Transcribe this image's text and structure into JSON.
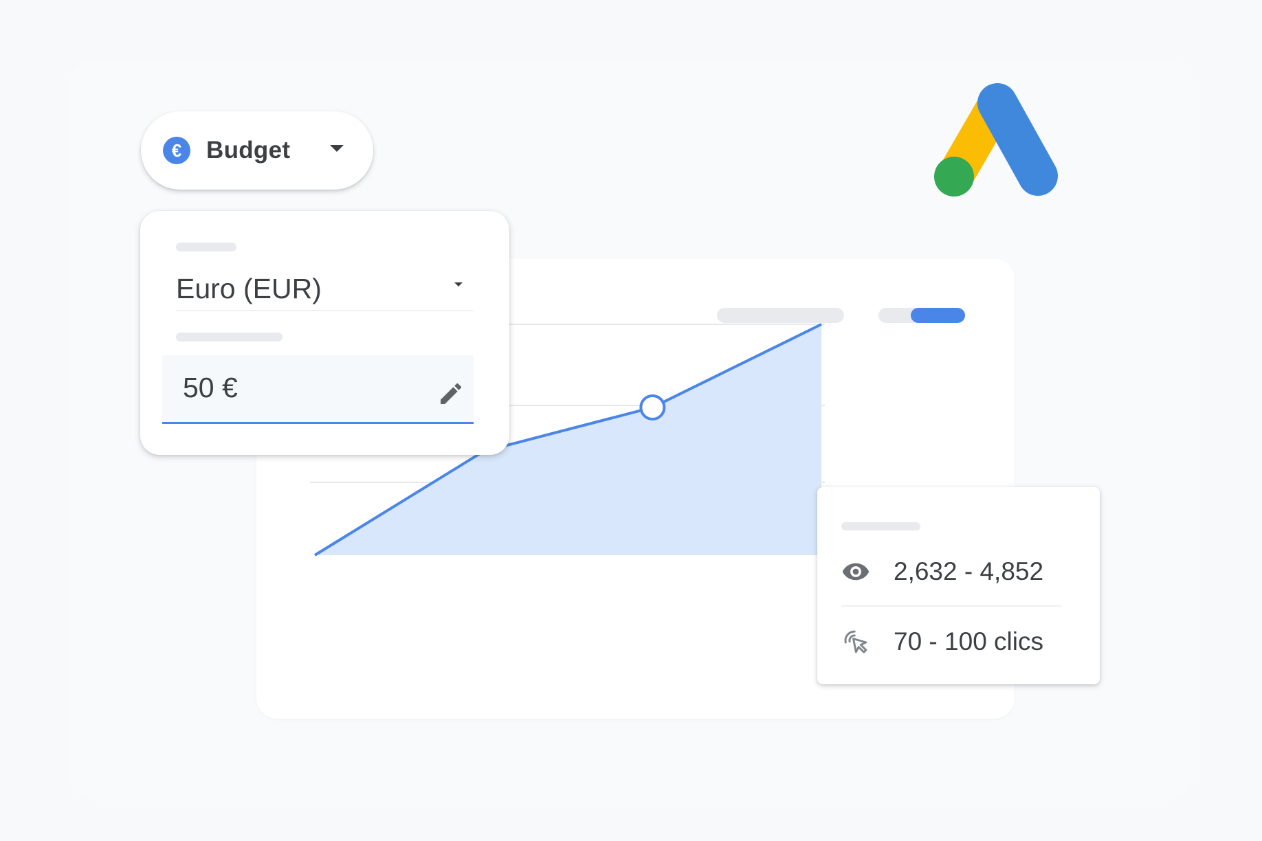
{
  "budget_selector": {
    "label": "Budget",
    "currency_symbol": "€",
    "icon": "euro-icon"
  },
  "currency_panel": {
    "currency_value": "Euro (EUR)",
    "amount_value": "50 €",
    "edit_icon": "pencil-icon"
  },
  "metrics": {
    "impressions": "2,632 - 4,852",
    "clicks": "70 - 100 clics",
    "impressions_icon": "eye-icon",
    "clicks_icon": "click-cursor-icon"
  },
  "colors": {
    "accent_blue": "#4a86e8",
    "area_fill": "#d8e7fb",
    "logo_blue": "#3f88dc",
    "logo_yellow": "#fbbc04",
    "logo_green": "#34a853"
  },
  "chart_data": {
    "type": "area",
    "x": [
      0,
      1,
      2,
      3
    ],
    "values": [
      0,
      1.35,
      1.92,
      3.0
    ],
    "highlighted_index": 2,
    "ylim": [
      0,
      3
    ],
    "grid": true
  }
}
